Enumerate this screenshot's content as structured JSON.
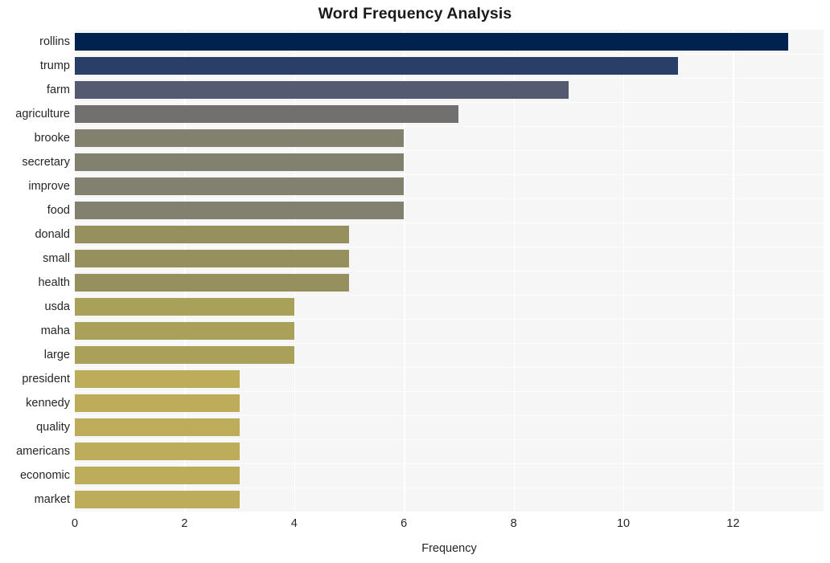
{
  "chart_data": {
    "type": "bar",
    "orientation": "horizontal",
    "title": "Word Frequency Analysis",
    "xlabel": "Frequency",
    "ylabel": "",
    "categories": [
      "rollins",
      "trump",
      "farm",
      "agriculture",
      "brooke",
      "secretary",
      "improve",
      "food",
      "donald",
      "small",
      "health",
      "usda",
      "maha",
      "large",
      "president",
      "kennedy",
      "quality",
      "americans",
      "economic",
      "market"
    ],
    "values": [
      13,
      11,
      9,
      7,
      6,
      6,
      6,
      6,
      5,
      5,
      5,
      4,
      4,
      4,
      3,
      3,
      3,
      3,
      3,
      3
    ],
    "xlim": [
      0,
      13.65
    ],
    "xticks": [
      0,
      2,
      4,
      6,
      8,
      10,
      12
    ],
    "xtick_labels": [
      "0",
      "2",
      "4",
      "6",
      "8",
      "10",
      "12"
    ],
    "grid": true,
    "grid_axis": "x",
    "legend": false,
    "colormap": "cividis",
    "bar_colors": [
      "#00224e",
      "#2a3f६8",
      "#545a६f",
      "#72706f",
      "#82806f",
      "#82806f",
      "#82806f",
      "#82806f",
      "#96905f",
      "#96905f",
      "#96905f",
      "#a9a05a",
      "#a9a05a",
      "#a9a05a",
      "#bdad५a",
      "#bdad5a",
      "#bdad5a",
      "#bdad5a",
      "#bdad5a",
      "#bdad5a"
    ],
    "plot_background": "#f6f6f7",
    "figure_background": "#ffffff",
    "text_color": "#262626"
  },
  "colors": {
    "bars": [
      "#00224e",
      "#2a3f68",
      "#545a6f",
      "#72706f",
      "#82806f",
      "#82806f",
      "#82806f",
      "#82806f",
      "#96905f",
      "#96905f",
      "#96905f",
      "#a9a05a",
      "#a9a05a",
      "#a9a05a",
      "#bdad5a",
      "#bdad5a",
      "#bdad5a",
      "#bdad5a",
      "#bdad5a",
      "#bdad5a"
    ]
  }
}
